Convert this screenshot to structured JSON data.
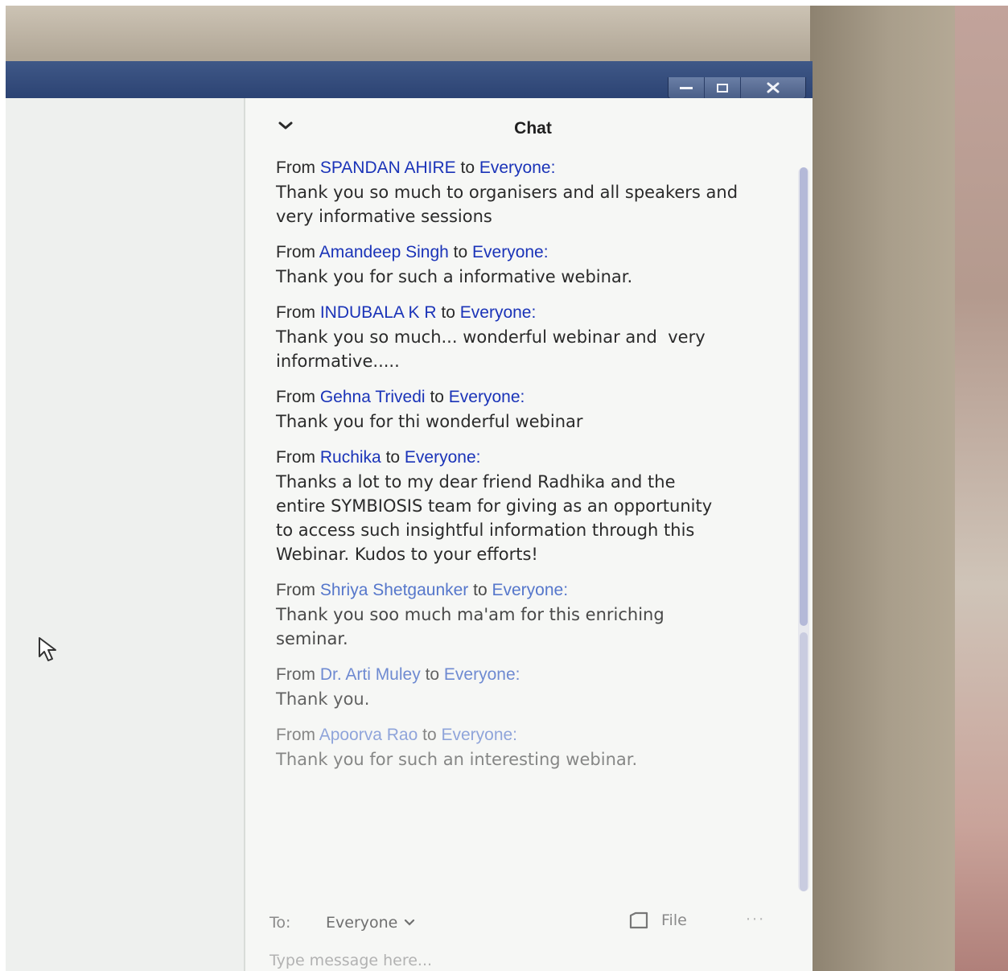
{
  "window": {
    "controls": {
      "minimize": "minimize-icon",
      "maximize": "restore-icon",
      "close": "close-icon"
    }
  },
  "chat": {
    "title": "Chat",
    "messages": [
      {
        "from_prefix": "From",
        "sender": "SPANDAN AHIRE",
        "to_word": "to",
        "recipient": "Everyone:",
        "text": "Thank you so much to organisers and all speakers and very informative sessions"
      },
      {
        "from_prefix": "From",
        "sender": "Amandeep Singh",
        "to_word": "to",
        "recipient": "Everyone:",
        "text": "Thank you for such a informative webinar."
      },
      {
        "from_prefix": "From",
        "sender": "INDUBALA K R",
        "to_word": "to",
        "recipient": "Everyone:",
        "text": "Thank you so much... wonderful webinar and  very informative....."
      },
      {
        "from_prefix": "From",
        "sender": "Gehna Trivedi",
        "to_word": "to",
        "recipient": "Everyone:",
        "text": "Thank you for thi wonderful webinar"
      },
      {
        "from_prefix": "From",
        "sender": "Ruchika",
        "to_word": "to",
        "recipient": "Everyone:",
        "text": "Thanks a lot to my dear friend Radhika and the entire SYMBIOSIS team for giving as an opportunity to access such insightful information through this Webinar. Kudos to your efforts!"
      },
      {
        "from_prefix": "From",
        "sender": "Shriya Shetgaunker",
        "to_word": "to",
        "recipient": "Everyone:",
        "text": "Thank you soo much ma'am for this enriching seminar."
      },
      {
        "from_prefix": "From",
        "sender": "Dr. Arti Muley",
        "to_word": "to",
        "recipient": "Everyone:",
        "text": "Thank you."
      },
      {
        "from_prefix": "From",
        "sender": "Apoorva Rao",
        "to_word": "to",
        "recipient": "Everyone:",
        "text": "Thank you for such an interesting webinar."
      }
    ],
    "composer": {
      "to_label": "To:",
      "recipient": "Everyone",
      "file_label": "File",
      "more": "···",
      "placeholder": "Type message here..."
    }
  },
  "colors": {
    "title_bar": "#2c4373",
    "sender_link": "#1a33b8",
    "chat_background": "#f6f7f5"
  }
}
